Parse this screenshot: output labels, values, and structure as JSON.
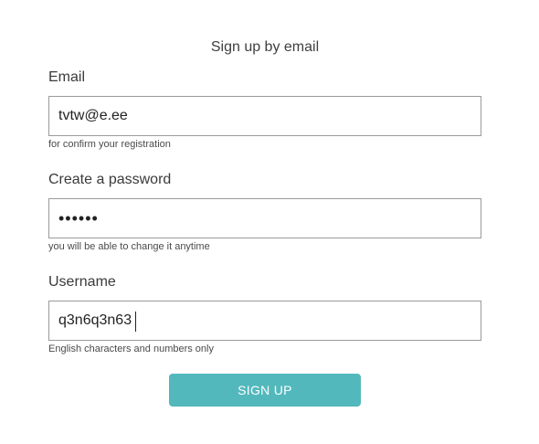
{
  "form": {
    "title": "Sign up by email",
    "email": {
      "label": "Email",
      "value": "tvtw@e.ee",
      "hint": "for confirm your registration"
    },
    "password": {
      "label": "Create a password",
      "value": "oooooo",
      "hint": "you will be able to change it anytime"
    },
    "username": {
      "label": "Username",
      "value": "q3n6q3n63",
      "hint": "English characters and numbers only"
    },
    "submit_label": "SIGN UP"
  },
  "colors": {
    "button_background": "#52b8bc",
    "button_text": "#ffffff",
    "input_border": "#9a9a9a"
  }
}
